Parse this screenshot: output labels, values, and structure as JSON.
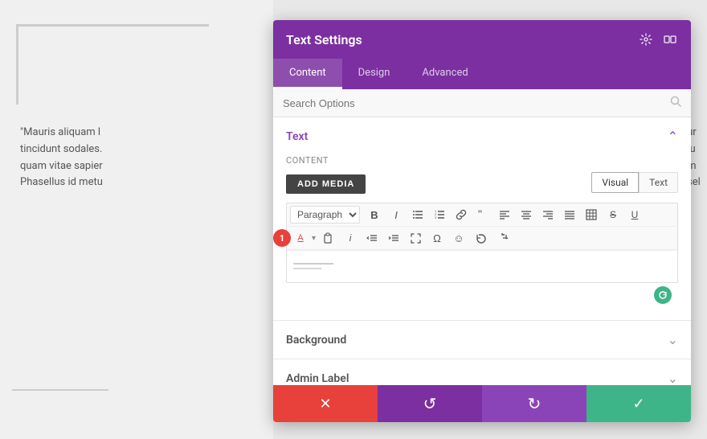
{
  "page": {
    "background_text_left": "\"Mauris aliquam l\ntincidunt sodales.\nquam vitae sapier\nPhasellus id metu",
    "background_text_right": "aur\nidu\nam \nasel"
  },
  "modal": {
    "title": "Text Settings",
    "tabs": [
      {
        "label": "Content",
        "active": true
      },
      {
        "label": "Design",
        "active": false
      },
      {
        "label": "Advanced",
        "active": false
      }
    ],
    "search_placeholder": "Search Options",
    "sections": {
      "text": {
        "title": "Text",
        "expanded": true,
        "content_label": "Content",
        "add_media_label": "ADD MEDIA",
        "editor_tabs": [
          {
            "label": "Visual",
            "active": true
          },
          {
            "label": "Text",
            "active": false
          }
        ],
        "toolbar": {
          "paragraph_select": "Paragraph",
          "buttons": [
            "B",
            "I",
            "ul",
            "ol",
            "link",
            "quote",
            "align-left",
            "align-center",
            "align-right",
            "align-justify",
            "table",
            "strike",
            "underline",
            "color",
            "copy",
            "italic2",
            "indent-left",
            "indent-right",
            "fullscreen",
            "omega",
            "emoji",
            "undo",
            "redo"
          ]
        }
      },
      "background": {
        "title": "Background",
        "expanded": false
      },
      "admin_label": {
        "title": "Admin Label",
        "expanded": false
      }
    }
  },
  "footer": {
    "cancel_icon": "✕",
    "undo_icon": "↺",
    "redo_icon": "↻",
    "confirm_icon": "✓"
  },
  "step_badge": "1"
}
